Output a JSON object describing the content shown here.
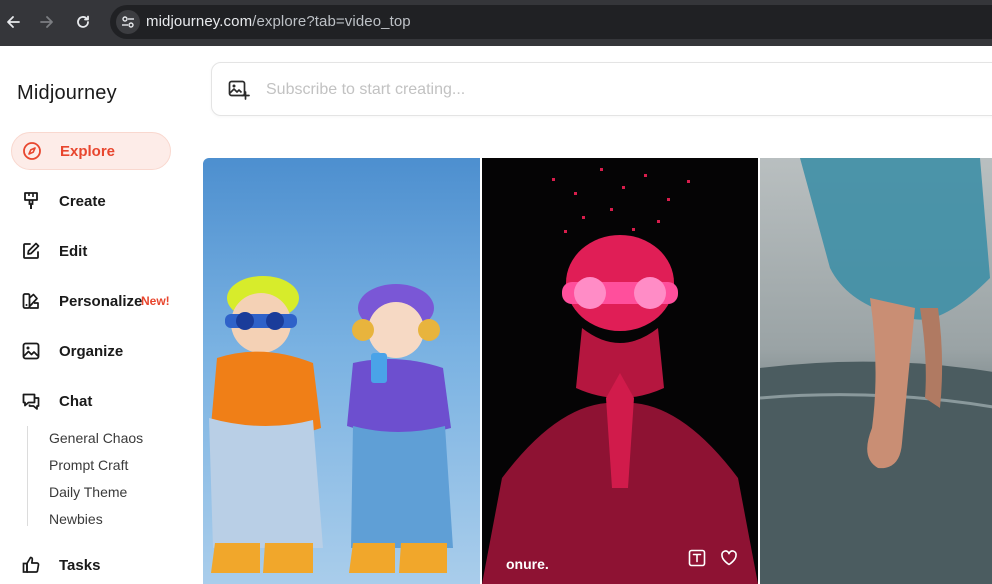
{
  "browser": {
    "url_domain": "midjourney.com",
    "url_path": "/explore?tab=video_top"
  },
  "sidebar": {
    "brand": "Midjourney",
    "items": [
      {
        "label": "Explore",
        "icon": "compass-icon",
        "active": true
      },
      {
        "label": "Create",
        "icon": "brush-icon"
      },
      {
        "label": "Edit",
        "icon": "edit-icon"
      },
      {
        "label": "Personalize",
        "icon": "palette-icon",
        "badge": "New!"
      },
      {
        "label": "Organize",
        "icon": "image-icon"
      },
      {
        "label": "Chat",
        "icon": "chat-icon"
      },
      {
        "label": "Tasks",
        "icon": "thumbs-up-icon"
      }
    ],
    "chat_channels": [
      "General Chaos",
      "Prompt Craft",
      "Daily Theme",
      "Newbies"
    ]
  },
  "search": {
    "placeholder": "Subscribe to start creating..."
  },
  "gallery": {
    "tiles": [
      {
        "caption": ""
      },
      {
        "caption": "onure."
      },
      {
        "caption": ""
      }
    ]
  },
  "colors": {
    "accent": "#e8462e",
    "active_bg": "#fdece8",
    "chrome": "#35363a"
  }
}
